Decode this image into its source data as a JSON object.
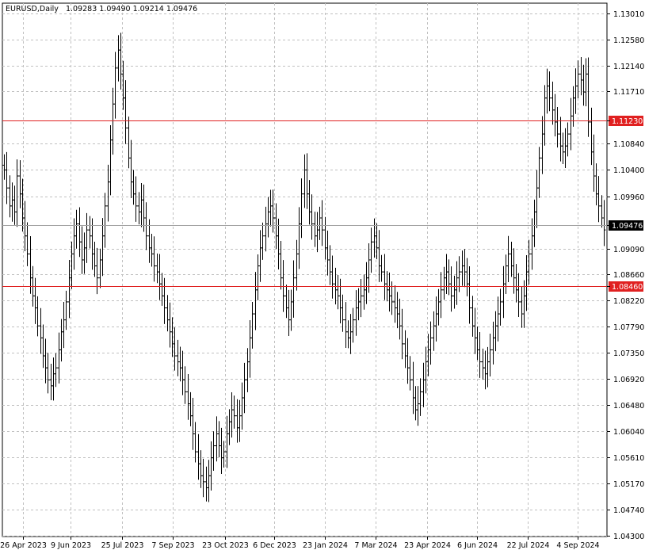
{
  "header": {
    "symbol": "EURUSD,Daily",
    "ohlc": "1.09283 1.09490 1.09214 1.09476"
  },
  "colors": {
    "bar": "#000000",
    "grid": "#c0c0c0",
    "level_line": "#e02020",
    "level_tag": "#e02020",
    "current_tag": "#000000",
    "background": "#ffffff"
  },
  "chart_data": {
    "type": "ohlc",
    "title": "EURUSD,Daily",
    "xlabel": "",
    "ylabel": "",
    "ylim": [
      1.043,
      1.1301
    ],
    "y_ticks": [
      "1.13010",
      "1.12580",
      "1.12140",
      "1.11710",
      "1.11230",
      "1.10840",
      "1.10400",
      "1.09960",
      "1.09476",
      "1.09090",
      "1.08660",
      "1.08460",
      "1.08220",
      "1.07790",
      "1.07350",
      "1.06920",
      "1.06480",
      "1.06040",
      "1.05610",
      "1.05170",
      "1.04740",
      "1.04300"
    ],
    "x_ticks": [
      "26 Apr 2023",
      "9 Jun 2023",
      "25 Jul 2023",
      "7 Sep 2023",
      "23 Oct 2023",
      "6 Dec 2023",
      "23 Jan 2024",
      "7 Mar 2024",
      "23 Apr 2024",
      "6 Jun 2024",
      "22 Jul 2024",
      "4 Sep 2024"
    ],
    "grid": true,
    "horizontal_lines": [
      {
        "value": 1.1123,
        "label": "1.11230"
      },
      {
        "value": 1.0846,
        "label": "1.08460"
      }
    ],
    "current_price": {
      "value": 1.09476,
      "label": "1.09476"
    },
    "series": [
      {
        "values": [
          1.104,
          1.101,
          1.098,
          1.099,
          1.097,
          1.103,
          1.1,
          1.096,
          1.093,
          1.09,
          1.086,
          1.083,
          1.081,
          1.078,
          1.076,
          1.073,
          1.071,
          1.069,
          1.068,
          1.07,
          1.071,
          1.074,
          1.077,
          1.079,
          1.082,
          1.086,
          1.09,
          1.093,
          1.095,
          1.092,
          1.089,
          1.091,
          1.094,
          1.093,
          1.09,
          1.088,
          1.086,
          1.089,
          1.093,
          1.098,
          1.102,
          1.109,
          1.115,
          1.121,
          1.124,
          1.12,
          1.116,
          1.111,
          1.106,
          1.102,
          1.1,
          1.098,
          1.097,
          1.099,
          1.096,
          1.093,
          1.091,
          1.09,
          1.088,
          1.087,
          1.085,
          1.083,
          1.081,
          1.079,
          1.077,
          1.075,
          1.073,
          1.072,
          1.071,
          1.069,
          1.067,
          1.065,
          1.063,
          1.06,
          1.057,
          1.055,
          1.053,
          1.052,
          1.051,
          1.053,
          1.056,
          1.058,
          1.06,
          1.058,
          1.056,
          1.057,
          1.06,
          1.062,
          1.064,
          1.063,
          1.061,
          1.063,
          1.066,
          1.069,
          1.072,
          1.076,
          1.08,
          1.084,
          1.088,
          1.091,
          1.093,
          1.095,
          1.097,
          1.098,
          1.096,
          1.093,
          1.09,
          1.086,
          1.083,
          1.081,
          1.079,
          1.082,
          1.086,
          1.09,
          1.095,
          1.1,
          1.104,
          1.1,
          1.097,
          1.095,
          1.093,
          1.094,
          1.096,
          1.094,
          1.091,
          1.089,
          1.087,
          1.085,
          1.084,
          1.083,
          1.081,
          1.079,
          1.077,
          1.076,
          1.077,
          1.079,
          1.081,
          1.082,
          1.083,
          1.084,
          1.086,
          1.089,
          1.092,
          1.093,
          1.091,
          1.088,
          1.087,
          1.085,
          1.084,
          1.083,
          1.082,
          1.081,
          1.08,
          1.078,
          1.075,
          1.073,
          1.071,
          1.069,
          1.066,
          1.064,
          1.065,
          1.067,
          1.069,
          1.072,
          1.074,
          1.076,
          1.078,
          1.08,
          1.082,
          1.084,
          1.086,
          1.087,
          1.085,
          1.083,
          1.084,
          1.086,
          1.087,
          1.088,
          1.087,
          1.085,
          1.081,
          1.078,
          1.076,
          1.074,
          1.072,
          1.071,
          1.07,
          1.072,
          1.074,
          1.076,
          1.078,
          1.08,
          1.082,
          1.085,
          1.088,
          1.09,
          1.088,
          1.086,
          1.084,
          1.082,
          1.08,
          1.083,
          1.087,
          1.09,
          1.093,
          1.097,
          1.101,
          1.106,
          1.11,
          1.116,
          1.118,
          1.116,
          1.114,
          1.112,
          1.11,
          1.108,
          1.107,
          1.108,
          1.11,
          1.113,
          1.116,
          1.118,
          1.12,
          1.119,
          1.117,
          1.12,
          1.112,
          1.107,
          1.103,
          1.1,
          1.098,
          1.096,
          1.094
        ]
      }
    ]
  }
}
